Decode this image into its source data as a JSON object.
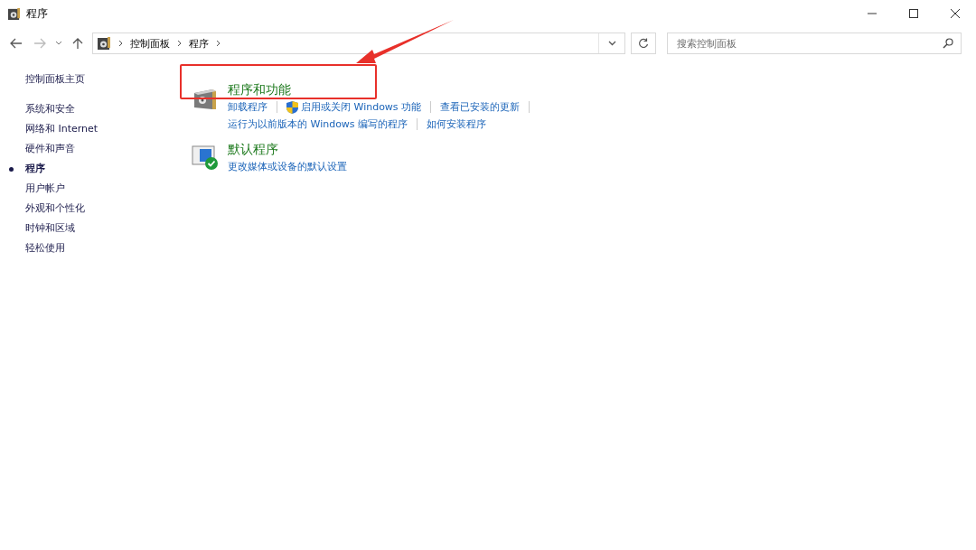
{
  "window": {
    "title": "程序"
  },
  "address_bar": {
    "crumbs": [
      "控制面板",
      "程序"
    ]
  },
  "search": {
    "placeholder": "搜索控制面板"
  },
  "sidebar": {
    "home": "控制面板主页",
    "items": [
      {
        "label": "系统和安全",
        "selected": false
      },
      {
        "label": "网络和 Internet",
        "selected": false
      },
      {
        "label": "硬件和声音",
        "selected": false
      },
      {
        "label": "程序",
        "selected": true
      },
      {
        "label": "用户帐户",
        "selected": false
      },
      {
        "label": "外观和个性化",
        "selected": false
      },
      {
        "label": "时钟和区域",
        "selected": false
      },
      {
        "label": "轻松使用",
        "selected": false
      }
    ]
  },
  "sections": [
    {
      "kind": "programs",
      "title": "程序和功能",
      "link_rows": [
        [
          {
            "label": "卸载程序",
            "shield": false
          },
          {
            "label": "启用或关闭 Windows 功能",
            "shield": true
          },
          {
            "label": "查看已安装的更新",
            "shield": false
          }
        ],
        [
          {
            "label": "运行为以前版本的 Windows 编写的程序",
            "shield": false
          },
          {
            "label": "如何安装程序",
            "shield": false
          }
        ]
      ]
    },
    {
      "kind": "defaults",
      "title": "默认程序",
      "link_rows": [
        [
          {
            "label": "更改媒体或设备的默认设置",
            "shield": false
          }
        ]
      ]
    }
  ]
}
